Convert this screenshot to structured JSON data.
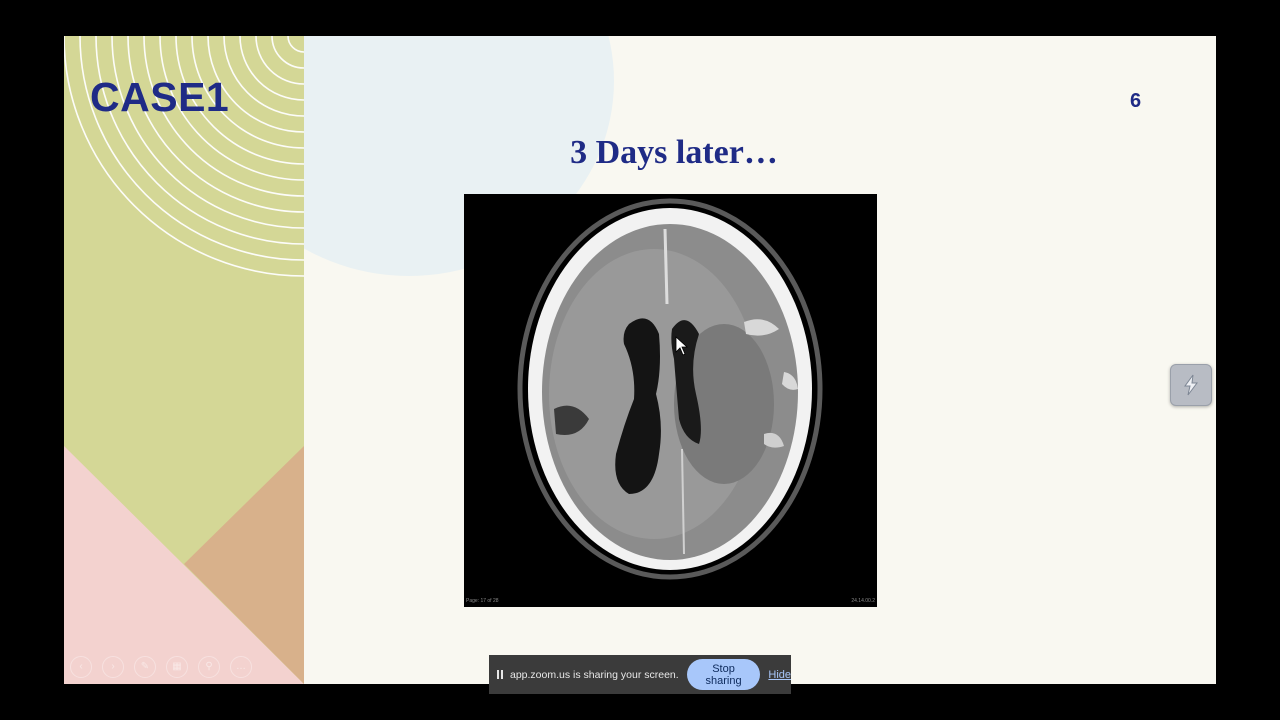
{
  "slide": {
    "case_title": "CASE1",
    "page_number": "6",
    "heading": "3 Days later…",
    "image_caption_left": "Page: 17 of 28",
    "image_caption_right": "24.14.00.2"
  },
  "colors": {
    "title_blue": "#1f2b86",
    "panel_green": "#d4d796",
    "panel_pink": "#f3d2cf",
    "panel_tan": "#d8b18b",
    "slide_background": "#f9f8f1"
  },
  "presenter_tools": [
    "back-icon",
    "forward-icon",
    "pen-icon",
    "grid-icon",
    "zoom-icon",
    "more-icon"
  ],
  "side_widget": {
    "icon": "lightning-icon"
  },
  "share_bar": {
    "message": "app.zoom.us is sharing your screen.",
    "stop_label": "Stop sharing",
    "hide_label": "Hide"
  }
}
